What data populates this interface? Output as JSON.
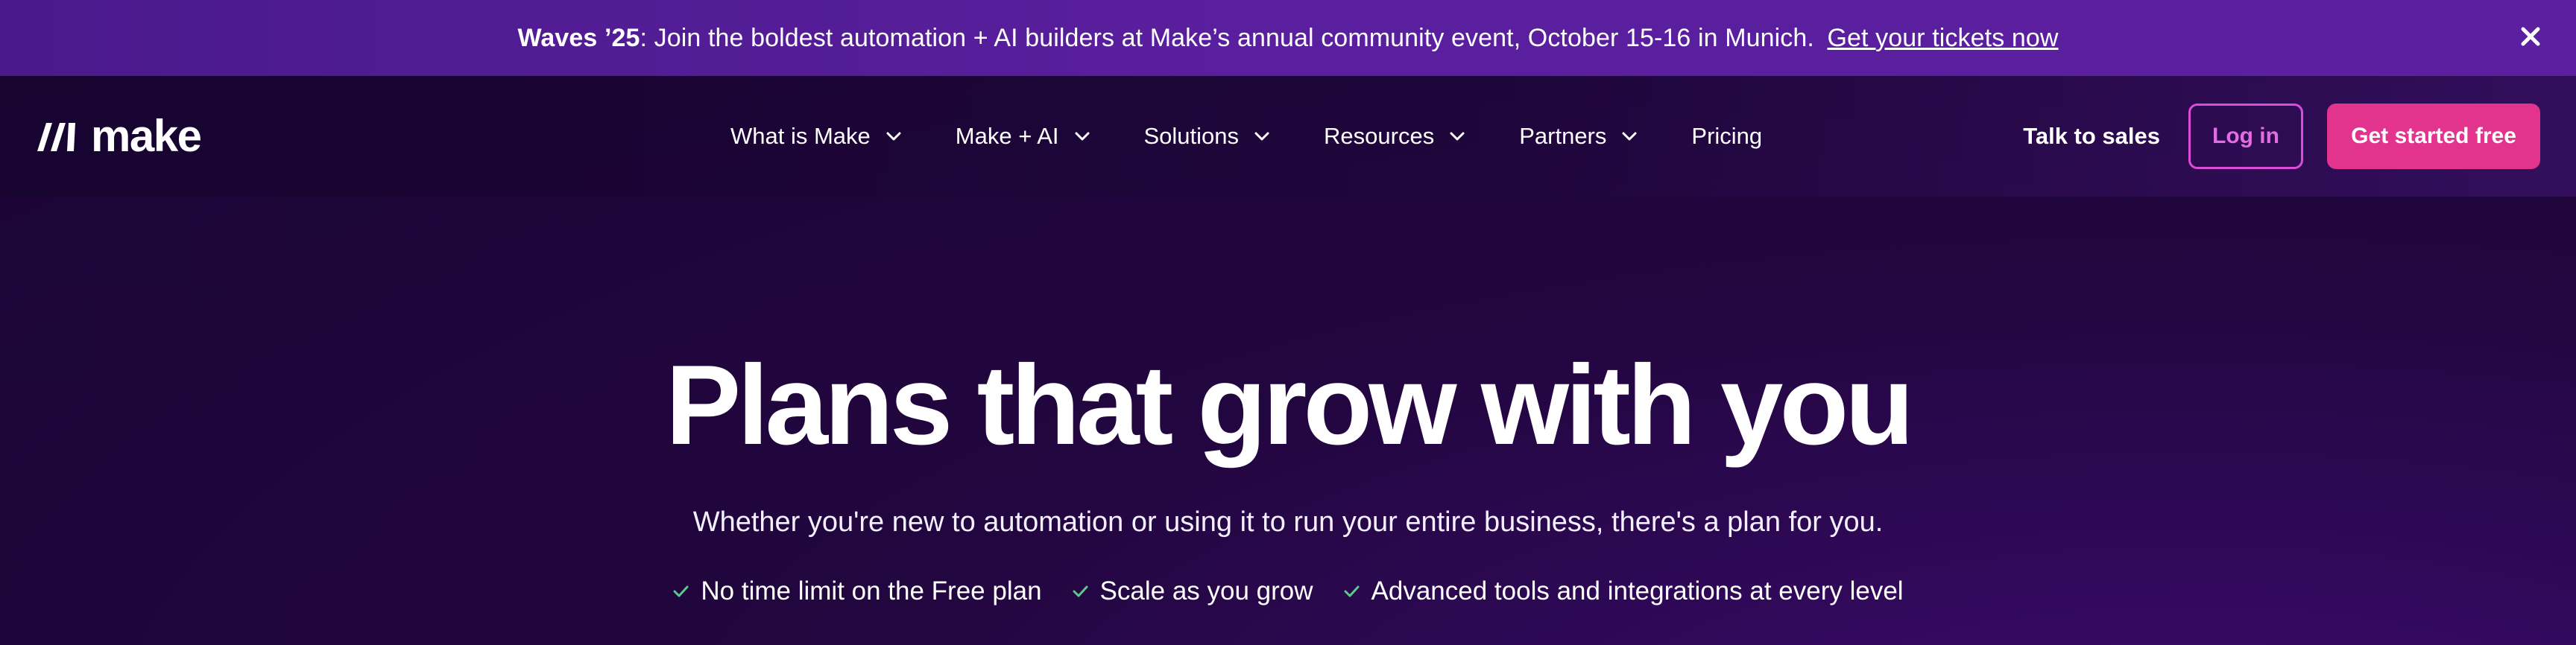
{
  "banner": {
    "strong": "Waves ’25",
    "text": ": Join the boldest automation + AI builders at Make’s annual community event, October 15-16 in Munich.",
    "link": "Get your tickets now",
    "close_icon": "close-icon"
  },
  "header": {
    "logo": {
      "text": "make",
      "icon": "make-logo-mark"
    },
    "nav": [
      {
        "label": "What is Make",
        "has_dropdown": true
      },
      {
        "label": "Make + AI",
        "has_dropdown": true
      },
      {
        "label": "Solutions",
        "has_dropdown": true
      },
      {
        "label": "Resources",
        "has_dropdown": true
      },
      {
        "label": "Partners",
        "has_dropdown": true
      },
      {
        "label": "Pricing",
        "has_dropdown": false
      }
    ],
    "talk_to_sales": "Talk to sales",
    "login": "Log in",
    "cta": "Get started free"
  },
  "hero": {
    "title": "Plans that grow with you",
    "subtitle": "Whether you're new to automation or using it to run your entire business, there's a plan for you.",
    "features": [
      "No time limit on the Free plan",
      "Scale as you grow",
      "Advanced tools and integrations at every level"
    ]
  },
  "colors": {
    "accent_pink": "#e2338d",
    "login_border": "#d94dd9",
    "banner_bg": "#5a1f9e",
    "page_bg": "#1d0538",
    "check_green": "#5cc98a"
  }
}
